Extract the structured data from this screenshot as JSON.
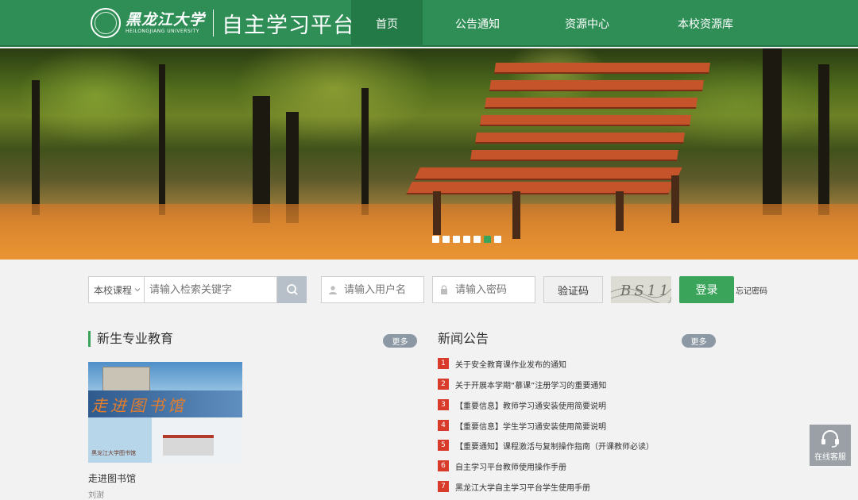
{
  "header": {
    "school_cn": "黑龙江大学",
    "school_en": "HEILONGJIANG UNIVERSITY",
    "platform_title": "自主学习平台",
    "nav": [
      {
        "label": "首页",
        "active": true
      },
      {
        "label": "公告通知",
        "active": false
      },
      {
        "label": "资源中心",
        "active": false
      },
      {
        "label": "本校资源库",
        "active": false
      }
    ]
  },
  "banner": {
    "slide_count": 7,
    "active_slide": 6
  },
  "search": {
    "scope": "本校课程",
    "placeholder": "请输入检索关键字"
  },
  "login": {
    "username_placeholder": "请输入用户名",
    "password_placeholder": "请输入密码",
    "captcha_label": "验证码",
    "captcha_text": "BS11",
    "login_button": "登录",
    "forgot_password": "忘记密码"
  },
  "left_section": {
    "title": "新生专业教育",
    "more": "更多",
    "card": {
      "image_text": "走进图书馆",
      "image_caption": "黑龙江大学图书馆",
      "title": "走进图书馆",
      "author": "刘澍"
    }
  },
  "right_section": {
    "title": "新闻公告",
    "more": "更多",
    "items": [
      {
        "num": "1",
        "text": "关于安全教育课作业发布的通知"
      },
      {
        "num": "2",
        "text": "关于开展本学期“慕课”注册学习的重要通知"
      },
      {
        "num": "3",
        "text": "【重要信息】教师学习通安装使用简要说明"
      },
      {
        "num": "4",
        "text": "【重要信息】学生学习通安装使用简要说明"
      },
      {
        "num": "5",
        "text": "【重要通知】课程激活与复制操作指南（开课教师必读）"
      },
      {
        "num": "6",
        "text": "自主学习平台教师使用操作手册"
      },
      {
        "num": "7",
        "text": "黑龙江大学自主学习平台学生使用手册"
      }
    ]
  },
  "service": {
    "label": "在线客服"
  },
  "colors": {
    "header_green": "#2e8e56",
    "nav_active": "#237a46",
    "accent_green": "#3aa55a",
    "news_badge": "#d93b2b",
    "more_badge": "#8c98a3"
  }
}
